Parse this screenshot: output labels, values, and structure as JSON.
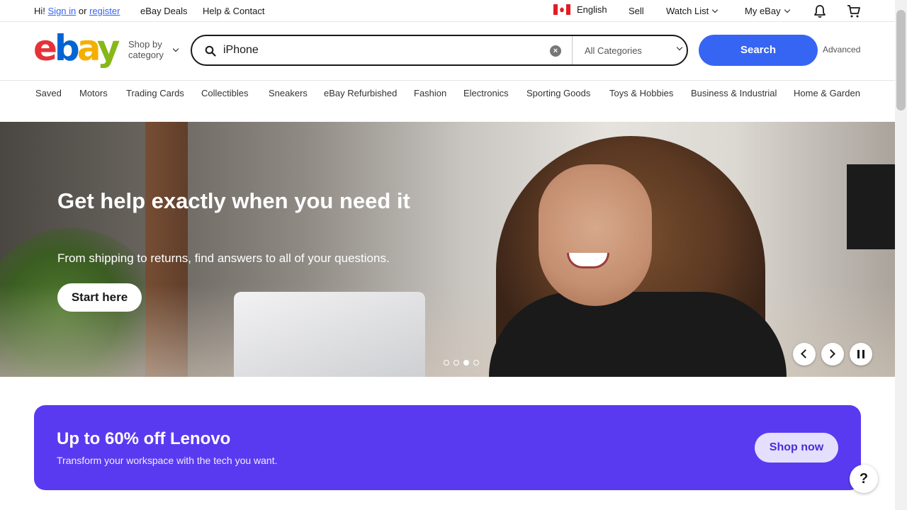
{
  "topbar": {
    "greeting": "Hi!",
    "sign_in": "Sign in",
    "or": "or",
    "register": "register",
    "deals": "eBay Deals",
    "help": "Help & Contact",
    "language": "English",
    "sell": "Sell",
    "watch_list": "Watch List",
    "my_ebay": "My eBay",
    "icons": {
      "flag": "canada-flag-icon",
      "bell": "bell-icon",
      "cart": "cart-icon"
    }
  },
  "header": {
    "logo": {
      "e": "e",
      "b": "b",
      "a": "a",
      "y": "y"
    },
    "shop_by_line1": "Shop by",
    "shop_by_line2": "category",
    "search": {
      "value": "iPhone",
      "category": "All Categories"
    },
    "search_button": "Search",
    "advanced": "Advanced"
  },
  "nav": [
    "Saved",
    "Motors",
    "Trading Cards",
    "Collectibles",
    "Sneakers",
    "eBay Refurbished",
    "Fashion",
    "Electronics",
    "Sporting Goods",
    "Toys & Hobbies",
    "Business & Industrial",
    "Home & Garden"
  ],
  "hero": {
    "title": "Get help exactly when you need it",
    "subtitle": "From shipping to returns, find answers to all of your questions.",
    "cta": "Start here",
    "slide_count": 4,
    "active_slide": 3
  },
  "promo": {
    "title": "Up to 60% off Lenovo",
    "subtitle": "Transform your workspace with the tech you want.",
    "cta": "Shop now"
  },
  "help_fab": "?",
  "colors": {
    "accent": "#3665f3",
    "promo": "#5a3af0"
  }
}
